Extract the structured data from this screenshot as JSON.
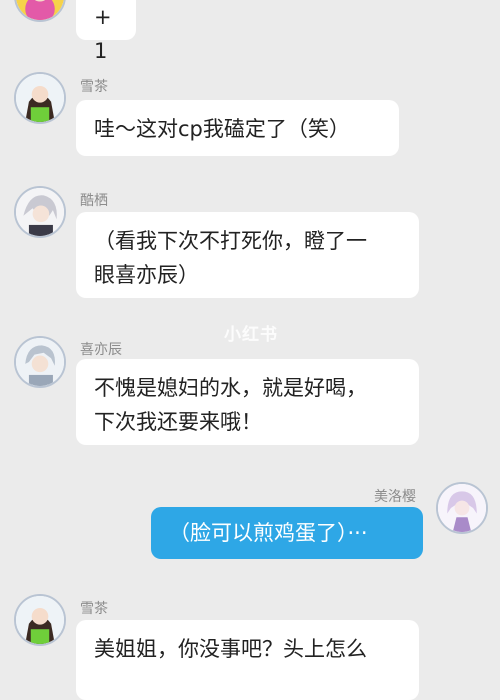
{
  "watermark": "小红书",
  "messages": [
    {
      "sender": "",
      "text": "+1",
      "direction": "in"
    },
    {
      "sender": "雪茶",
      "text": "哇～这对cp我磕定了（笑）",
      "direction": "in"
    },
    {
      "sender": "酷栖",
      "text": "（看我下次不打死你，瞪了一\n眼喜亦辰）",
      "direction": "in"
    },
    {
      "sender": "喜亦辰",
      "text": "不愧是媳妇的水，就是好喝，\n下次我还要来哦！",
      "direction": "in"
    },
    {
      "sender": "美洛樱",
      "text": "（脸可以煎鸡蛋了）···",
      "direction": "out"
    },
    {
      "sender": "雪茶",
      "text": "美姐姐，你没事吧？头上怎么",
      "direction": "in"
    }
  ],
  "colors": {
    "background": "#ebebeb",
    "incoming_bubble": "#ffffff",
    "outgoing_bubble": "#2ea7e6",
    "name_text": "#8c8c8c"
  }
}
